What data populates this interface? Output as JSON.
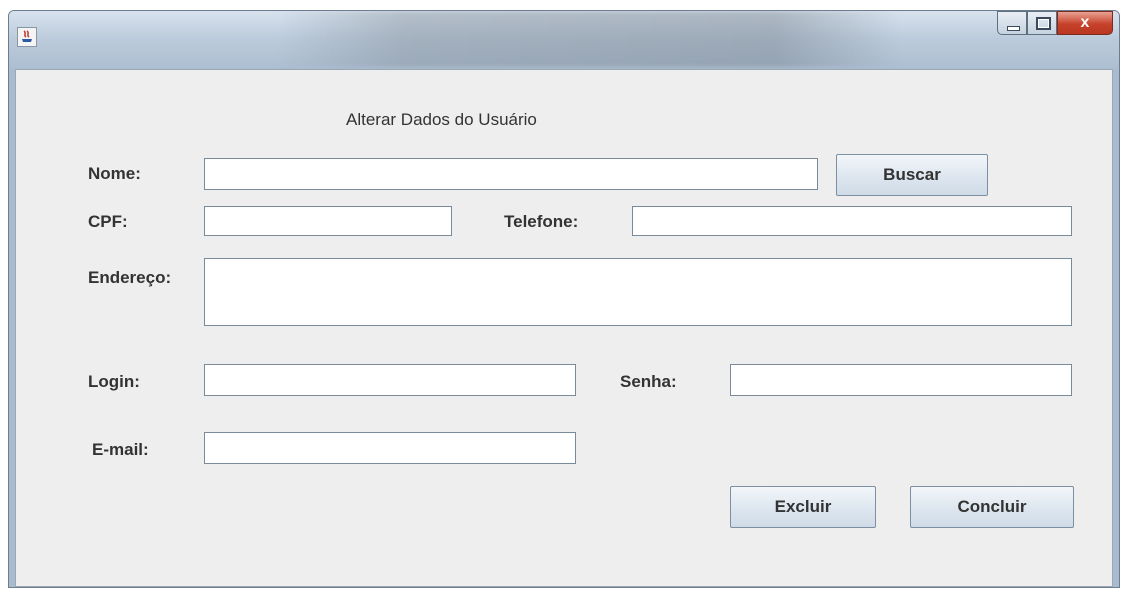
{
  "window": {
    "controls": {
      "minimize_icon": "minimize-icon",
      "maximize_icon": "maximize-icon",
      "close_label": "x"
    }
  },
  "form": {
    "heading": "Alterar Dados do Usuário",
    "nome_label": "Nome:",
    "nome_value": "",
    "buscar_label": "Buscar",
    "cpf_label": "CPF:",
    "cpf_value": "",
    "telefone_label": "Telefone:",
    "telefone_value": "",
    "endereco_label": "Endereço:",
    "endereco_value": "",
    "login_label": "Login:",
    "login_value": "",
    "senha_label": "Senha:",
    "senha_value": "",
    "email_label": "E-mail:",
    "email_value": "",
    "excluir_label": "Excluir",
    "concluir_label": "Concluir"
  }
}
